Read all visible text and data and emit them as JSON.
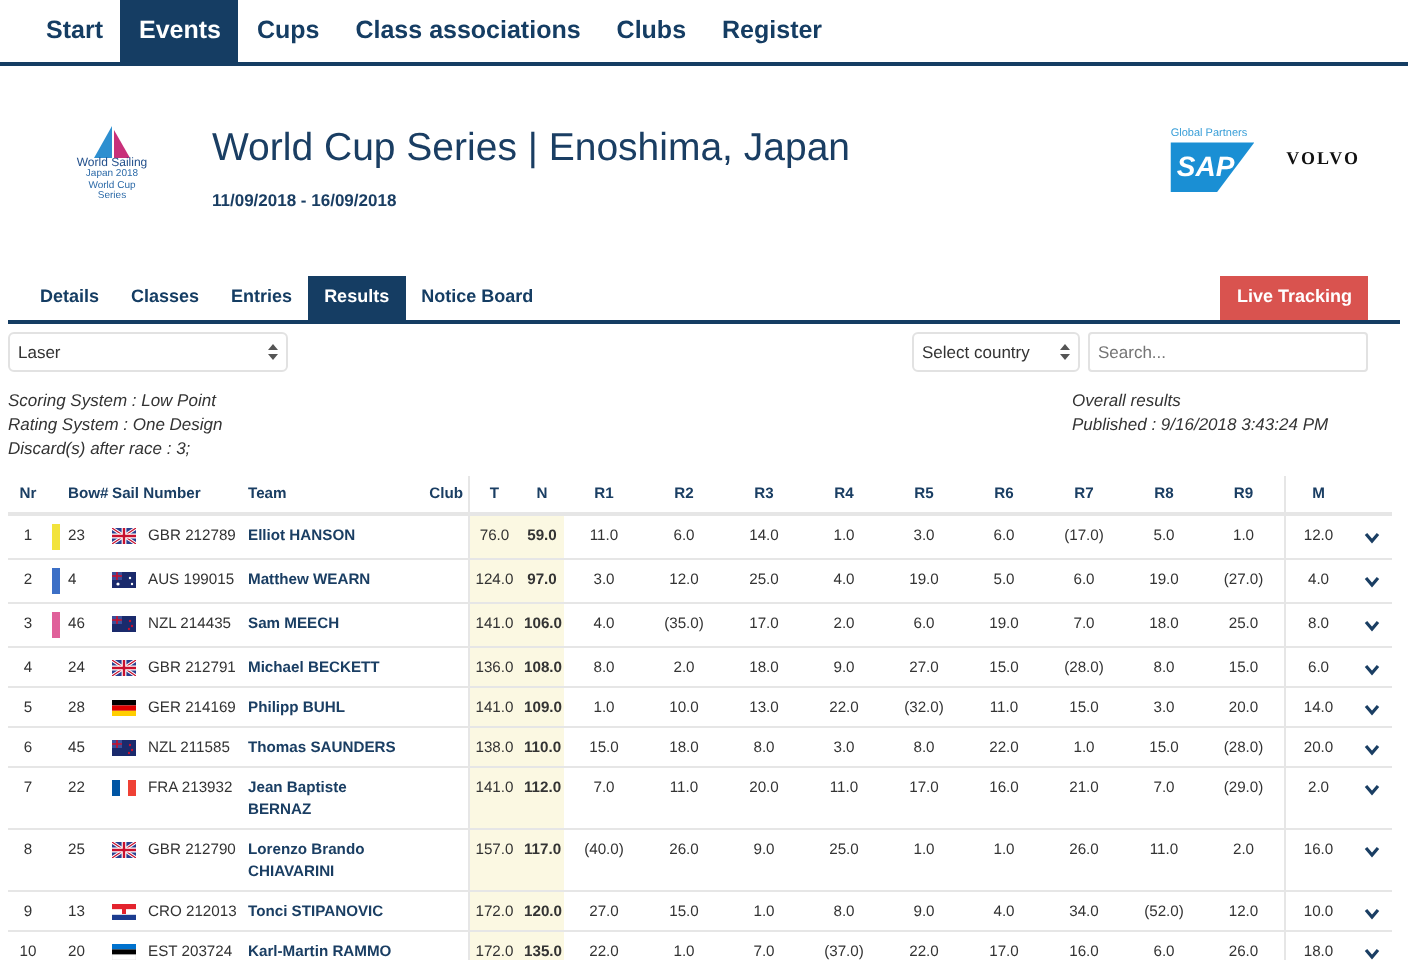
{
  "nav": [
    {
      "label": "Start",
      "selected": false
    },
    {
      "label": "Events",
      "selected": true
    },
    {
      "label": "Cups",
      "selected": false
    },
    {
      "label": "Class associations",
      "selected": false
    },
    {
      "label": "Clubs",
      "selected": false
    },
    {
      "label": "Register",
      "selected": false
    }
  ],
  "event": {
    "logo_texts": [
      "World Sailing",
      "Japan 2018",
      "World Cup",
      "Series"
    ],
    "title": "World Cup Series | Enoshima, Japan",
    "dates": "11/09/2018 - 16/09/2018"
  },
  "sponsors": {
    "caption": "Global Partners",
    "sap": "SAP",
    "volvo": "VOLVO"
  },
  "tabs": [
    {
      "label": "Details",
      "selected": false
    },
    {
      "label": "Classes",
      "selected": false
    },
    {
      "label": "Entries",
      "selected": false
    },
    {
      "label": "Results",
      "selected": true
    },
    {
      "label": "Notice Board",
      "selected": false
    }
  ],
  "live_tracking": "Live Tracking",
  "class_select": {
    "value": "Laser"
  },
  "country_select": {
    "value": "Select country"
  },
  "search": {
    "placeholder": "Search..."
  },
  "info": [
    "Scoring System : Low Point",
    "Rating System : One Design",
    "Discard(s) after race : 3;"
  ],
  "overall": {
    "title": "Overall results",
    "published": "Published : 9/16/2018 3:43:24 PM"
  },
  "table": {
    "columns": [
      "Nr",
      "Bow#",
      "Sail Number",
      "Team",
      "Club",
      "T",
      "N",
      "R1",
      "R2",
      "R3",
      "R4",
      "R5",
      "R6",
      "R7",
      "R8",
      "R9",
      "M"
    ],
    "rows": [
      {
        "nr": "1",
        "color": "#f2e33c",
        "bow": "23",
        "kind": "gb",
        "sail": "GBR 212789",
        "team": "Elliot HANSON",
        "t": "76.0",
        "n": "59.0",
        "races": [
          "11.0",
          "6.0",
          "14.0",
          "1.0",
          "3.0",
          "6.0",
          "(17.0)",
          "5.0",
          "1.0"
        ],
        "m": "12.0"
      },
      {
        "nr": "2",
        "color": "#3c6fc6",
        "bow": "4",
        "kind": "au",
        "sail": "AUS 199015",
        "team": "Matthew WEARN",
        "t": "124.0",
        "n": "97.0",
        "races": [
          "3.0",
          "12.0",
          "25.0",
          "4.0",
          "19.0",
          "5.0",
          "6.0",
          "19.0",
          "(27.0)"
        ],
        "m": "4.0"
      },
      {
        "nr": "3",
        "color": "#e0609a",
        "bow": "46",
        "kind": "nz",
        "sail": "NZL 214435",
        "team": "Sam MEECH",
        "t": "141.0",
        "n": "106.0",
        "races": [
          "4.0",
          "(35.0)",
          "17.0",
          "2.0",
          "6.0",
          "19.0",
          "7.0",
          "18.0",
          "25.0"
        ],
        "m": "8.0"
      },
      {
        "nr": "4",
        "bow": "24",
        "kind": "gb",
        "sail": "GBR 212791",
        "team": "Michael BECKETT",
        "t": "136.0",
        "n": "108.0",
        "races": [
          "8.0",
          "2.0",
          "18.0",
          "9.0",
          "27.0",
          "15.0",
          "(28.0)",
          "8.0",
          "15.0"
        ],
        "m": "6.0"
      },
      {
        "nr": "5",
        "bow": "28",
        "kind": "de",
        "sail": "GER 214169",
        "team": "Philipp BUHL",
        "t": "141.0",
        "n": "109.0",
        "races": [
          "1.0",
          "10.0",
          "13.0",
          "22.0",
          "(32.0)",
          "11.0",
          "15.0",
          "3.0",
          "20.0"
        ],
        "m": "14.0"
      },
      {
        "nr": "6",
        "bow": "45",
        "kind": "nz",
        "sail": "NZL 211585",
        "team": "Thomas SAUNDERS",
        "t": "138.0",
        "n": "110.0",
        "races": [
          "15.0",
          "18.0",
          "8.0",
          "3.0",
          "8.0",
          "22.0",
          "1.0",
          "15.0",
          "(28.0)"
        ],
        "m": "20.0"
      },
      {
        "nr": "7",
        "bow": "22",
        "kind": "fr",
        "sail": "FRA 213932",
        "team": "Jean Baptiste BERNAZ",
        "t": "141.0",
        "n": "112.0",
        "races": [
          "7.0",
          "11.0",
          "20.0",
          "11.0",
          "17.0",
          "16.0",
          "21.0",
          "7.0",
          "(29.0)"
        ],
        "m": "2.0"
      },
      {
        "nr": "8",
        "bow": "25",
        "kind": "gb",
        "sail": "GBR 212790",
        "team": "Lorenzo Brando CHIAVARINI",
        "t": "157.0",
        "n": "117.0",
        "races": [
          "(40.0)",
          "26.0",
          "9.0",
          "25.0",
          "1.0",
          "1.0",
          "26.0",
          "11.0",
          "2.0"
        ],
        "m": "16.0"
      },
      {
        "nr": "9",
        "bow": "13",
        "kind": "hr",
        "sail": "CRO 212013",
        "team": "Tonci STIPANOVIC",
        "t": "172.0",
        "n": "120.0",
        "races": [
          "27.0",
          "15.0",
          "1.0",
          "8.0",
          "9.0",
          "4.0",
          "34.0",
          "(52.0)",
          "12.0"
        ],
        "m": "10.0"
      },
      {
        "nr": "10",
        "bow": "20",
        "kind": "ee",
        "sail": "EST 203724",
        "team": "Karl-Martin RAMMO",
        "t": "172.0",
        "n": "135.0",
        "races": [
          "22.0",
          "1.0",
          "7.0",
          "(37.0)",
          "22.0",
          "17.0",
          "16.0",
          "6.0",
          "26.0"
        ],
        "m": "18.0"
      }
    ]
  }
}
